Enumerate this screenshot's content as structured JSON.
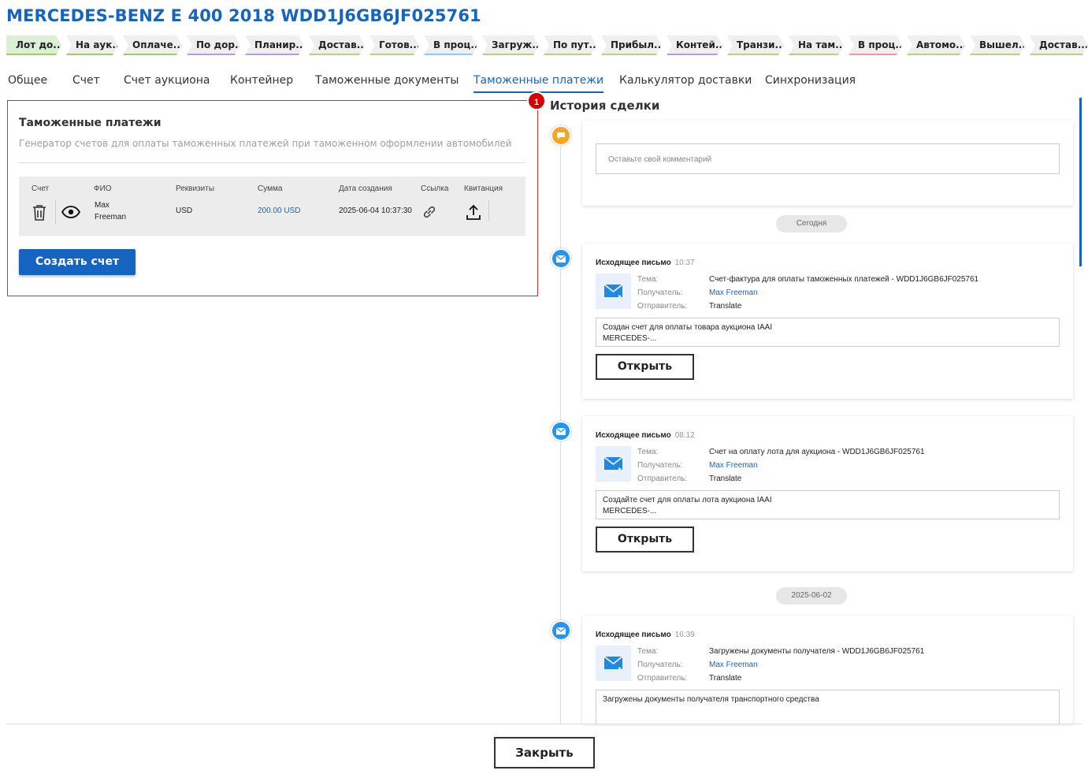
{
  "header": {
    "title": "MERCEDES-BENZ E 400 2018 WDD1J6GB6JF025761"
  },
  "stages": [
    {
      "label": "Лот до...",
      "color": "#9ccc65",
      "bg": "#dcf0d5"
    },
    {
      "label": "На аук...",
      "color": "#9ccc65",
      "bg": "#efefef"
    },
    {
      "label": "Оплаче...",
      "color": "#9ccc65",
      "bg": "#efefef"
    },
    {
      "label": "По дор...",
      "color": "#b39ddb",
      "bg": "#efefef"
    },
    {
      "label": "Планир...",
      "color": "#b39ddb",
      "bg": "#efefef"
    },
    {
      "label": "Достав...",
      "color": "#aed581",
      "bg": "#efefef"
    },
    {
      "label": "Готов...",
      "color": "#aed581",
      "bg": "#efefef"
    },
    {
      "label": "В проц...",
      "color": "#90caf9",
      "bg": "#efefef"
    },
    {
      "label": "Загруж...",
      "color": "#aed581",
      "bg": "#efefef"
    },
    {
      "label": "По пут...",
      "color": "#aed581",
      "bg": "#efefef"
    },
    {
      "label": "Прибыл...",
      "color": "#aed581",
      "bg": "#efefef"
    },
    {
      "label": "Контей...",
      "color": "#b39ddb",
      "bg": "#efefef"
    },
    {
      "label": "Транзи...",
      "color": "#aed581",
      "bg": "#efefef"
    },
    {
      "label": "На там...",
      "color": "#aed581",
      "bg": "#efefef"
    },
    {
      "label": "В проц...",
      "color": "#ef9a9a",
      "bg": "#efefef"
    },
    {
      "label": "Автомо...",
      "color": "#aed581",
      "bg": "#efefef"
    },
    {
      "label": "Вышел...",
      "color": "#aed581",
      "bg": "#efefef"
    },
    {
      "label": "Достав...",
      "color": "#aed581",
      "bg": "#efefef"
    }
  ],
  "tabs": [
    {
      "label": "Общее"
    },
    {
      "label": "Счет"
    },
    {
      "label": "Счет аукциона"
    },
    {
      "label": "Контейнер"
    },
    {
      "label": "Таможенные документы"
    },
    {
      "label": "Таможенные платежи",
      "active": true
    },
    {
      "label": "Калькулятор доставки"
    },
    {
      "label": "Синхронизация"
    }
  ],
  "customs": {
    "badge": "1",
    "title": "Таможенные платежи",
    "description": "Генератор счетов для оплаты таможенных платежей при таможенном оформлении автомобилей",
    "columns": [
      "Счет",
      "ФИО",
      "Реквизиты",
      "Сумма",
      "Дата создания",
      "Ссылка",
      "Квитанция"
    ],
    "row": {
      "name_line1": "Max",
      "name_line2": "Freeman",
      "requisites": "USD",
      "amount": "200.00 USD",
      "created": "2025-06-04 10:37:30"
    },
    "create_button": "Создать счет",
    "icons": {
      "delete": "trash-icon",
      "view": "eye-icon",
      "link": "link-icon",
      "receipt": "upload-icon"
    }
  },
  "history": {
    "title": "История сделки",
    "comment_placeholder": "Оставьте свой комментарий",
    "labels": {
      "subject": "Тема:",
      "recipient": "Получатель:",
      "sender": "Отправитель:"
    },
    "open_label": "Открыть",
    "dates": [
      "Сегодня",
      "2025-06-02"
    ],
    "emails": [
      {
        "type": "Исходящее письмо",
        "time": "10:37",
        "subject": "Счет-фактура для оплаты таможенных платежей - WDD1J6GB6JF025761",
        "recipient": "Max Freeman",
        "sender": "Translate",
        "body_line1": "Создан счет для оплаты товара аукциона IAAI",
        "body_line2": "MERCEDES-..."
      },
      {
        "type": "Исходящее письмо",
        "time": "08:12",
        "subject": "Счет на оплату лота для аукциона - WDD1J6GB6JF025761",
        "recipient": "Max Freeman",
        "sender": "Translate",
        "body_line1": "Создайте счет для оплаты лота аукциона IAAI",
        "body_line2": "MERCEDES-..."
      },
      {
        "type": "Исходящее письмо",
        "time": "16:39",
        "subject": "Загружены документы получателя - WDD1J6GB6JF025761",
        "recipient": "Max Freeman",
        "sender": "Translate",
        "body_line1": "Загружены документы получателя транспортного средства",
        "body_line2": ""
      }
    ]
  },
  "footer": {
    "close_label": "Закрыть"
  },
  "colors": {
    "accent": "#1565c0",
    "highlight_border": "#d32f2f",
    "comment_dot": "#f5a623",
    "mail_dot": "#2196f3"
  }
}
